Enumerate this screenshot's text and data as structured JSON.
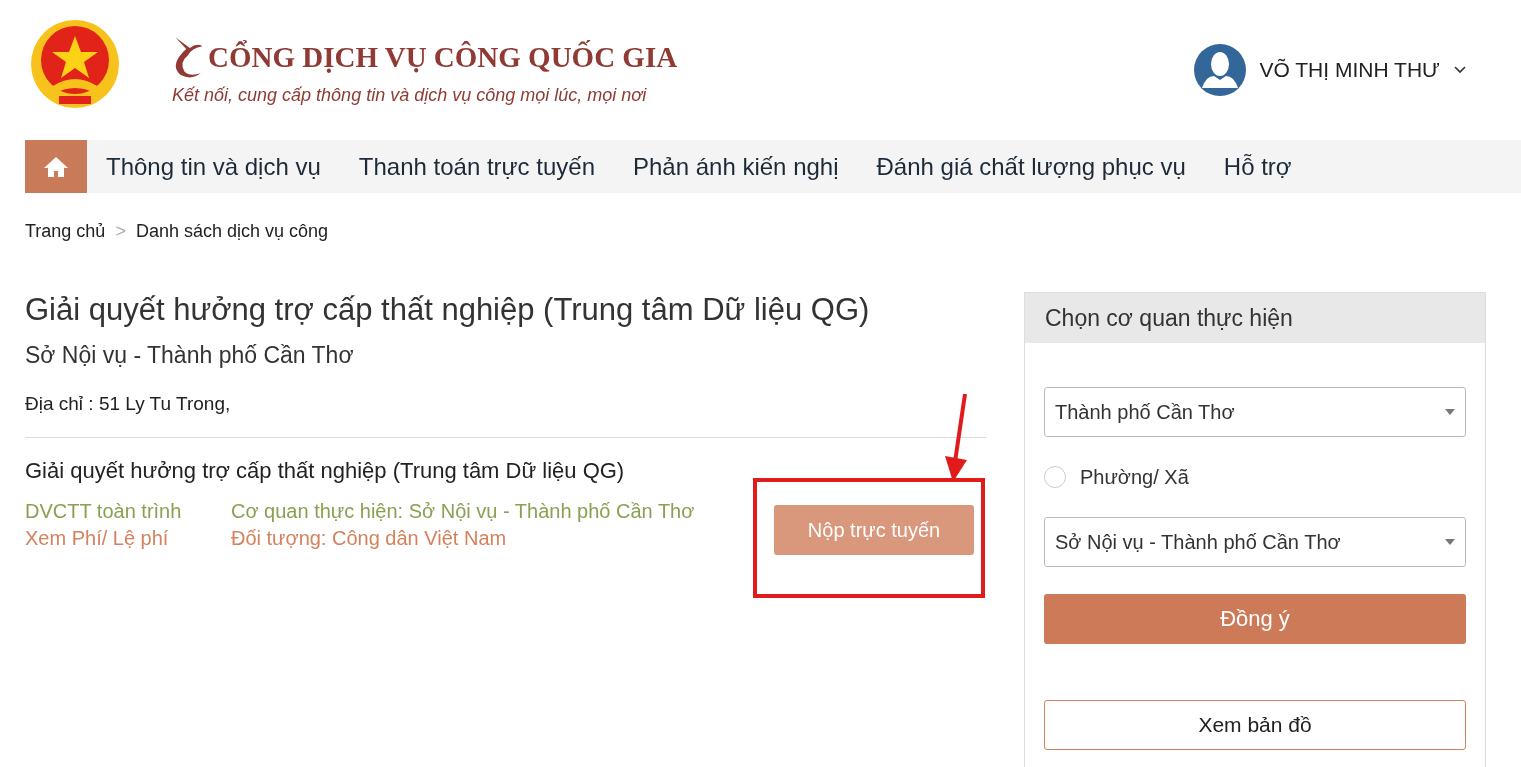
{
  "header": {
    "title": "CỔNG DỊCH VỤ CÔNG QUỐC GIA",
    "subtitle": "Kết nối, cung cấp thông tin và dịch vụ công mọi lúc, mọi nơi",
    "user": "VÕ THỊ MINH THƯ"
  },
  "nav": [
    {
      "label": "Thông tin và dịch vụ"
    },
    {
      "label": "Thanh toán trực tuyến"
    },
    {
      "label": "Phản ánh kiến nghị"
    },
    {
      "label": "Đánh giá chất lượng phục vụ"
    },
    {
      "label": "Hỗ trợ"
    }
  ],
  "breadcrumb": [
    {
      "label": "Trang chủ"
    },
    {
      "label": "Danh sách dịch vụ công"
    }
  ],
  "breadcrumb_separator": ">",
  "page_title": "Giải quyết hưởng trợ cấp thất nghiệp (Trung tâm Dữ liệu QG)",
  "agency": "Sở Nội vụ - Thành phố Cần Thơ",
  "address": "Địa chỉ : 51 Ly Tu Trong,",
  "service": {
    "title": "Giải quyết hưởng trợ cấp thất nghiệp (Trung tâm Dữ liệu QG)",
    "level": "DVCTT toàn trình",
    "fee_link": "Xem Phí/ Lệ phí",
    "agency": "Cơ quan thực hiện: Sở Nội vụ - Thành phố Cần Thơ",
    "target": "Đối tượng: Công dân Việt Nam",
    "submit": "Nộp trực tuyến"
  },
  "panel": {
    "title": "Chọn cơ quan thực hiện",
    "province": "Thành phố Cần Thơ",
    "ward_option": {
      "label": "Phường/ Xã",
      "selected": false
    },
    "agency_select": "Sở Nội vụ - Thành phố Cần Thơ",
    "confirm": "Đồng ý",
    "map": "Xem bản đồ"
  }
}
